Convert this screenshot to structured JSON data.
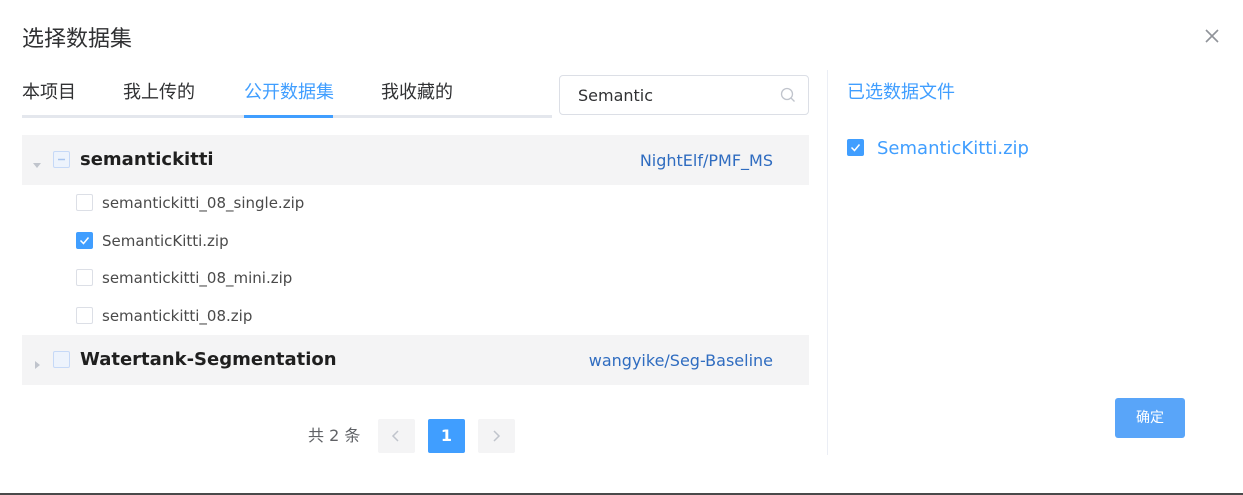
{
  "dialog": {
    "title": "选择数据集"
  },
  "tabs": [
    {
      "label": "本项目",
      "active": false
    },
    {
      "label": "我上传的",
      "active": false
    },
    {
      "label": "公开数据集",
      "active": true
    },
    {
      "label": "我收藏的",
      "active": false
    }
  ],
  "search": {
    "value": "Semantic",
    "placeholder": ""
  },
  "datasets": [
    {
      "name": "semantickitti",
      "owner": "NightElf/PMF_MS",
      "expanded": true,
      "state": "indeterminate",
      "files": [
        {
          "name": "semantickitti_08_single.zip",
          "checked": false
        },
        {
          "name": "SemanticKitti.zip",
          "checked": true
        },
        {
          "name": "semantickitti_08_mini.zip",
          "checked": false
        },
        {
          "name": "semantickitti_08.zip",
          "checked": false
        }
      ]
    },
    {
      "name": "Watertank-Segmentation",
      "owner": "wangyike/Seg-Baseline",
      "expanded": false,
      "state": "unchecked",
      "files": []
    }
  ],
  "pagination": {
    "total_text": "共 2 条",
    "current_page": "1"
  },
  "selected_panel": {
    "title": "已选数据文件",
    "files": [
      {
        "name": "SemanticKitti.zip",
        "checked": true
      }
    ]
  },
  "confirm_label": "确定",
  "colors": {
    "accent": "#409eff",
    "link": "#2f6cc0",
    "confirm_bg": "#59a5f9",
    "group_bg": "#f4f4f5"
  },
  "icons": {
    "close": "close-icon",
    "search": "search-icon",
    "expand_down": "caret-down-icon",
    "expand_right": "caret-right-icon",
    "check": "check-icon",
    "prev": "chevron-left-icon",
    "next": "chevron-right-icon"
  }
}
